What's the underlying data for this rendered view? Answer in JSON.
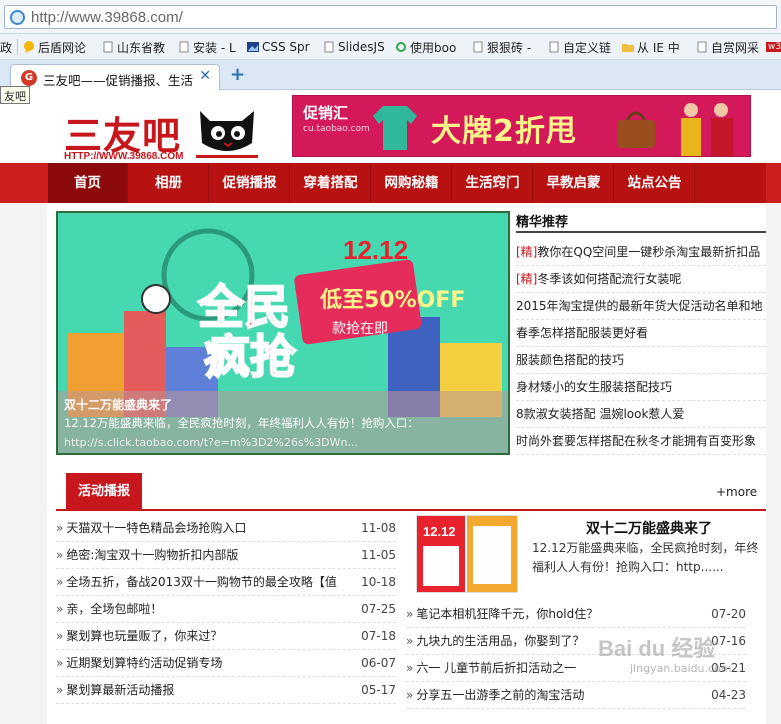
{
  "browser": {
    "url": "http://www.39868.com/",
    "bookmarks": [
      {
        "label": "政",
        "icon": "folder-icon"
      },
      {
        "label": "后盾网论",
        "icon": "speech-icon"
      },
      {
        "label": "山东省教",
        "icon": "page-icon"
      },
      {
        "label": "安装 - L",
        "icon": "page-icon"
      },
      {
        "label": "CSS Spr",
        "icon": "image-icon"
      },
      {
        "label": "SlidesJS",
        "icon": "page-icon"
      },
      {
        "label": "使用boo",
        "icon": "refresh-icon"
      },
      {
        "label": "狠狠砖 -",
        "icon": "page-icon"
      },
      {
        "label": "自定义链",
        "icon": "page-icon"
      },
      {
        "label": "从 IE 中",
        "icon": "folder-icon"
      },
      {
        "label": "自赏网采",
        "icon": "page-icon"
      },
      {
        "label": "w3",
        "icon": "w3-icon"
      }
    ],
    "tab_title": "三友吧——促销播报、生活",
    "tooltip": "友吧"
  },
  "header": {
    "logo_text": "三友吧",
    "logo_url": "HTTP://WWW.39868.COM",
    "banner_brand": "促销汇",
    "banner_brand_url": "cu.taobao.com",
    "banner_slogan": "大牌2折甩"
  },
  "nav": {
    "items": [
      "首页",
      "相册",
      "促销播报",
      "穿着搭配",
      "网购秘籍",
      "生活窍门",
      "早教启蒙",
      "站点公告"
    ],
    "active_index": 0
  },
  "hero": {
    "date_badge": "12.12",
    "headline": "全民疯抢",
    "discount": "低至50%OFF",
    "sub": "款抢在即",
    "caption_title": "双十二万能盛典来了",
    "caption_desc": "12.12万能盛典来临，全民疯抢时刻，年终福利人人有份！抢购入口：",
    "caption_url": "http://s.click.taobao.com/t?e=m%3D2%26s%3DWn..."
  },
  "featured": {
    "heading": "精华推荐",
    "items": [
      {
        "tag": "[精]",
        "text": "教你在QQ空间里一键秒杀淘宝最新折扣品"
      },
      {
        "tag": "[精]",
        "text": "冬季该如何搭配流行女装呢"
      },
      {
        "tag": "",
        "text": "2015年淘宝提供的最新年货大促活动名单和地"
      },
      {
        "tag": "",
        "text": "春季怎样搭配服装更好看"
      },
      {
        "tag": "",
        "text": "服装颜色搭配的技巧"
      },
      {
        "tag": "",
        "text": "身材矮小的女生服装搭配技巧"
      },
      {
        "tag": "",
        "text": "8款淑女装搭配 温婉look惹人爱"
      },
      {
        "tag": "",
        "text": "时尚外套要怎样搭配在秋冬才能拥有百变形象"
      }
    ]
  },
  "activity": {
    "tab_label": "活动播报",
    "more_label": "+more",
    "left_items": [
      {
        "text": "天猫双十一特色精品会场抢购入口",
        "date": "11-08"
      },
      {
        "text": "绝密:淘宝双十一购物折扣内部版",
        "date": "11-05"
      },
      {
        "text": "全场五折，备战2013双十一购物节的最全攻略【值",
        "date": "10-18"
      },
      {
        "text": "亲，全场包邮啦！",
        "date": "07-25"
      },
      {
        "text": "聚划算也玩量贩了，你来过？",
        "date": "07-18"
      },
      {
        "text": "近期聚划算特约活动促销专场",
        "date": "06-07"
      },
      {
        "text": "聚划算最新活动播报",
        "date": "05-17"
      }
    ],
    "story": {
      "title": "双十二万能盛典来了",
      "desc": "12.12万能盛典来临，全民疯抢时刻，年终福利人人有份！抢购入口：http......",
      "thumb_badge": "12.12"
    },
    "right_items": [
      {
        "text": "笔记本相机狂降千元，你hold住？",
        "date": "07-20"
      },
      {
        "text": "九块九的生活用品，你娶到了？",
        "date": "07-16"
      },
      {
        "text": "六一 儿童节前后折扣活动之一",
        "date": "05-21"
      },
      {
        "text": "分享五一出游季之前的淘宝活动",
        "date": "04-23"
      }
    ]
  },
  "watermark": {
    "text": "Bai du 经验",
    "sub": "jingyan.baidu.com"
  },
  "colors": {
    "brand_red": "#c8161d",
    "nav_dark": "#b71111",
    "hero_bg": "#46d8b0",
    "banner_pink": "#d4195a"
  }
}
